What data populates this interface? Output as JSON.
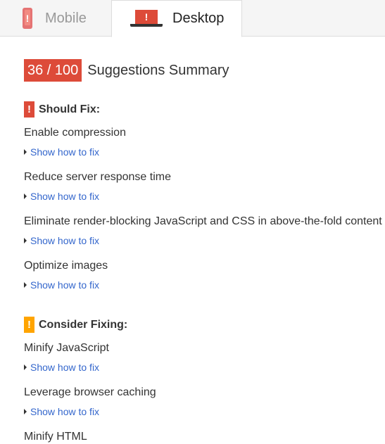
{
  "tabs": {
    "mobile": {
      "label": "Mobile",
      "icon": "mobile-phone-icon",
      "icon_glyph": "!"
    },
    "desktop": {
      "label": "Desktop",
      "icon": "laptop-icon",
      "icon_glyph": "!"
    }
  },
  "summary": {
    "score": "36 / 100",
    "title": "Suggestions Summary",
    "score_color": "#dd4b39"
  },
  "should_fix": {
    "heading": "Should Fix:",
    "icon_glyph": "!",
    "color": "#dd4b39",
    "items": [
      {
        "title": "Enable compression",
        "link": "Show how to fix"
      },
      {
        "title": "Reduce server response time",
        "link": "Show how to fix"
      },
      {
        "title": "Eliminate render-blocking JavaScript and CSS in above-the-fold content",
        "link": "Show how to fix"
      },
      {
        "title": "Optimize images",
        "link": "Show how to fix"
      }
    ]
  },
  "consider_fixing": {
    "heading": "Consider Fixing:",
    "icon_glyph": "!",
    "color": "#ffa400",
    "items": [
      {
        "title": "Minify JavaScript",
        "link": "Show how to fix"
      },
      {
        "title": "Leverage browser caching",
        "link": "Show how to fix"
      },
      {
        "title": "Minify HTML"
      }
    ]
  },
  "link_color": "#3366cc"
}
